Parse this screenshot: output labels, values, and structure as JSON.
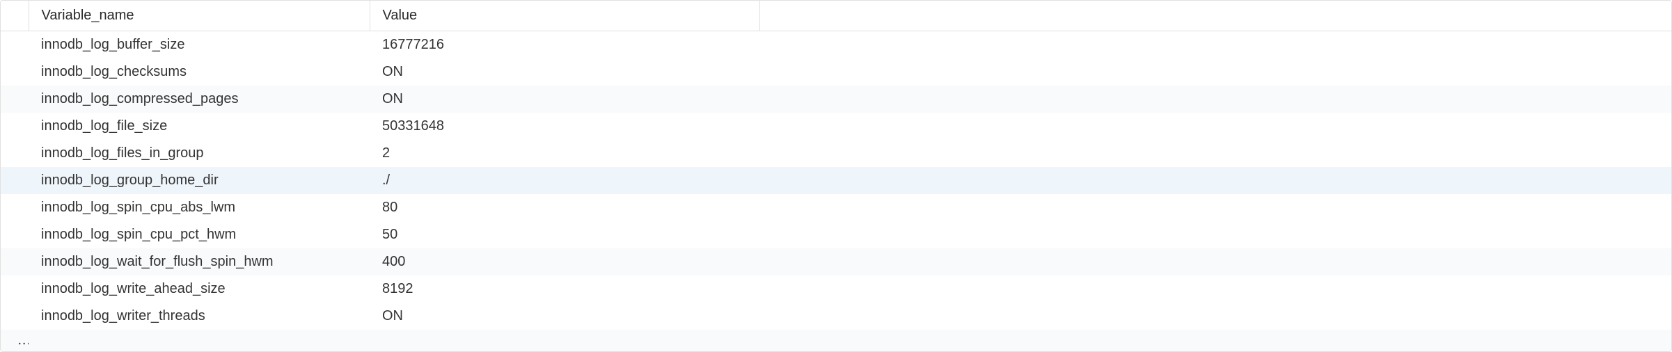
{
  "table": {
    "headers": {
      "variable_name": "Variable_name",
      "value": "Value"
    },
    "rows": [
      {
        "variable_name": "innodb_log_buffer_size",
        "value": "16777216",
        "striped": false,
        "selected": false
      },
      {
        "variable_name": "innodb_log_checksums",
        "value": "ON",
        "striped": false,
        "selected": false
      },
      {
        "variable_name": "innodb_log_compressed_pages",
        "value": "ON",
        "striped": true,
        "selected": false
      },
      {
        "variable_name": "innodb_log_file_size",
        "value": "50331648",
        "striped": false,
        "selected": false
      },
      {
        "variable_name": "innodb_log_files_in_group",
        "value": "2",
        "striped": false,
        "selected": false
      },
      {
        "variable_name": "innodb_log_group_home_dir",
        "value": "./",
        "striped": false,
        "selected": true
      },
      {
        "variable_name": "innodb_log_spin_cpu_abs_lwm",
        "value": "80",
        "striped": false,
        "selected": false
      },
      {
        "variable_name": "innodb_log_spin_cpu_pct_hwm",
        "value": "50",
        "striped": false,
        "selected": false
      },
      {
        "variable_name": "innodb_log_wait_for_flush_spin_hwm",
        "value": "400",
        "striped": true,
        "selected": false
      },
      {
        "variable_name": "innodb_log_write_ahead_size",
        "value": "8192",
        "striped": false,
        "selected": false
      },
      {
        "variable_name": "innodb_log_writer_threads",
        "value": "ON",
        "striped": false,
        "selected": false
      }
    ]
  }
}
